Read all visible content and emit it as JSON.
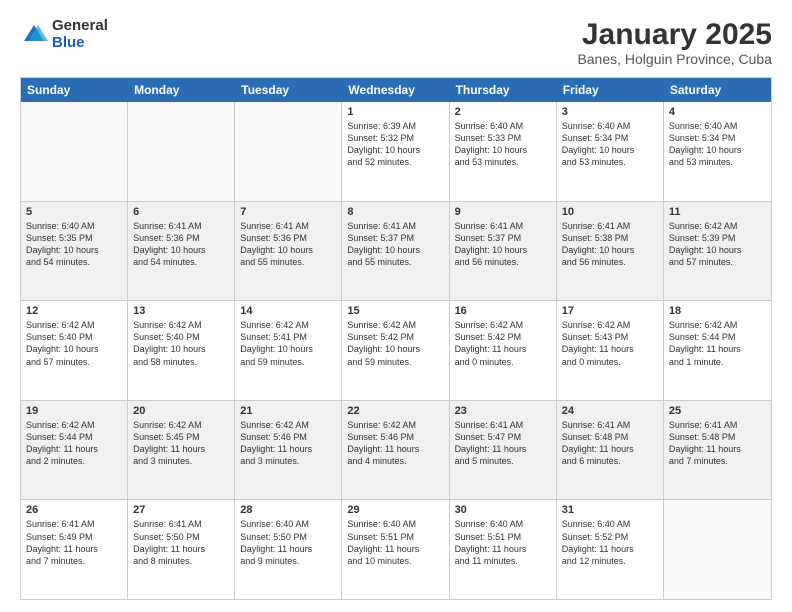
{
  "logo": {
    "general": "General",
    "blue": "Blue"
  },
  "header": {
    "title": "January 2025",
    "subtitle": "Banes, Holguin Province, Cuba"
  },
  "days": [
    "Sunday",
    "Monday",
    "Tuesday",
    "Wednesday",
    "Thursday",
    "Friday",
    "Saturday"
  ],
  "weeks": [
    [
      {
        "day": "",
        "info": ""
      },
      {
        "day": "",
        "info": ""
      },
      {
        "day": "",
        "info": ""
      },
      {
        "day": "1",
        "info": "Sunrise: 6:39 AM\nSunset: 5:32 PM\nDaylight: 10 hours\nand 52 minutes."
      },
      {
        "day": "2",
        "info": "Sunrise: 6:40 AM\nSunset: 5:33 PM\nDaylight: 10 hours\nand 53 minutes."
      },
      {
        "day": "3",
        "info": "Sunrise: 6:40 AM\nSunset: 5:34 PM\nDaylight: 10 hours\nand 53 minutes."
      },
      {
        "day": "4",
        "info": "Sunrise: 6:40 AM\nSunset: 5:34 PM\nDaylight: 10 hours\nand 53 minutes."
      }
    ],
    [
      {
        "day": "5",
        "info": "Sunrise: 6:40 AM\nSunset: 5:35 PM\nDaylight: 10 hours\nand 54 minutes."
      },
      {
        "day": "6",
        "info": "Sunrise: 6:41 AM\nSunset: 5:36 PM\nDaylight: 10 hours\nand 54 minutes."
      },
      {
        "day": "7",
        "info": "Sunrise: 6:41 AM\nSunset: 5:36 PM\nDaylight: 10 hours\nand 55 minutes."
      },
      {
        "day": "8",
        "info": "Sunrise: 6:41 AM\nSunset: 5:37 PM\nDaylight: 10 hours\nand 55 minutes."
      },
      {
        "day": "9",
        "info": "Sunrise: 6:41 AM\nSunset: 5:37 PM\nDaylight: 10 hours\nand 56 minutes."
      },
      {
        "day": "10",
        "info": "Sunrise: 6:41 AM\nSunset: 5:38 PM\nDaylight: 10 hours\nand 56 minutes."
      },
      {
        "day": "11",
        "info": "Sunrise: 6:42 AM\nSunset: 5:39 PM\nDaylight: 10 hours\nand 57 minutes."
      }
    ],
    [
      {
        "day": "12",
        "info": "Sunrise: 6:42 AM\nSunset: 5:40 PM\nDaylight: 10 hours\nand 57 minutes."
      },
      {
        "day": "13",
        "info": "Sunrise: 6:42 AM\nSunset: 5:40 PM\nDaylight: 10 hours\nand 58 minutes."
      },
      {
        "day": "14",
        "info": "Sunrise: 6:42 AM\nSunset: 5:41 PM\nDaylight: 10 hours\nand 59 minutes."
      },
      {
        "day": "15",
        "info": "Sunrise: 6:42 AM\nSunset: 5:42 PM\nDaylight: 10 hours\nand 59 minutes."
      },
      {
        "day": "16",
        "info": "Sunrise: 6:42 AM\nSunset: 5:42 PM\nDaylight: 11 hours\nand 0 minutes."
      },
      {
        "day": "17",
        "info": "Sunrise: 6:42 AM\nSunset: 5:43 PM\nDaylight: 11 hours\nand 0 minutes."
      },
      {
        "day": "18",
        "info": "Sunrise: 6:42 AM\nSunset: 5:44 PM\nDaylight: 11 hours\nand 1 minute."
      }
    ],
    [
      {
        "day": "19",
        "info": "Sunrise: 6:42 AM\nSunset: 5:44 PM\nDaylight: 11 hours\nand 2 minutes."
      },
      {
        "day": "20",
        "info": "Sunrise: 6:42 AM\nSunset: 5:45 PM\nDaylight: 11 hours\nand 3 minutes."
      },
      {
        "day": "21",
        "info": "Sunrise: 6:42 AM\nSunset: 5:46 PM\nDaylight: 11 hours\nand 3 minutes."
      },
      {
        "day": "22",
        "info": "Sunrise: 6:42 AM\nSunset: 5:46 PM\nDaylight: 11 hours\nand 4 minutes."
      },
      {
        "day": "23",
        "info": "Sunrise: 6:41 AM\nSunset: 5:47 PM\nDaylight: 11 hours\nand 5 minutes."
      },
      {
        "day": "24",
        "info": "Sunrise: 6:41 AM\nSunset: 5:48 PM\nDaylight: 11 hours\nand 6 minutes."
      },
      {
        "day": "25",
        "info": "Sunrise: 6:41 AM\nSunset: 5:48 PM\nDaylight: 11 hours\nand 7 minutes."
      }
    ],
    [
      {
        "day": "26",
        "info": "Sunrise: 6:41 AM\nSunset: 5:49 PM\nDaylight: 11 hours\nand 7 minutes."
      },
      {
        "day": "27",
        "info": "Sunrise: 6:41 AM\nSunset: 5:50 PM\nDaylight: 11 hours\nand 8 minutes."
      },
      {
        "day": "28",
        "info": "Sunrise: 6:40 AM\nSunset: 5:50 PM\nDaylight: 11 hours\nand 9 minutes."
      },
      {
        "day": "29",
        "info": "Sunrise: 6:40 AM\nSunset: 5:51 PM\nDaylight: 11 hours\nand 10 minutes."
      },
      {
        "day": "30",
        "info": "Sunrise: 6:40 AM\nSunset: 5:51 PM\nDaylight: 11 hours\nand 11 minutes."
      },
      {
        "day": "31",
        "info": "Sunrise: 6:40 AM\nSunset: 5:52 PM\nDaylight: 11 hours\nand 12 minutes."
      },
      {
        "day": "",
        "info": ""
      }
    ]
  ]
}
